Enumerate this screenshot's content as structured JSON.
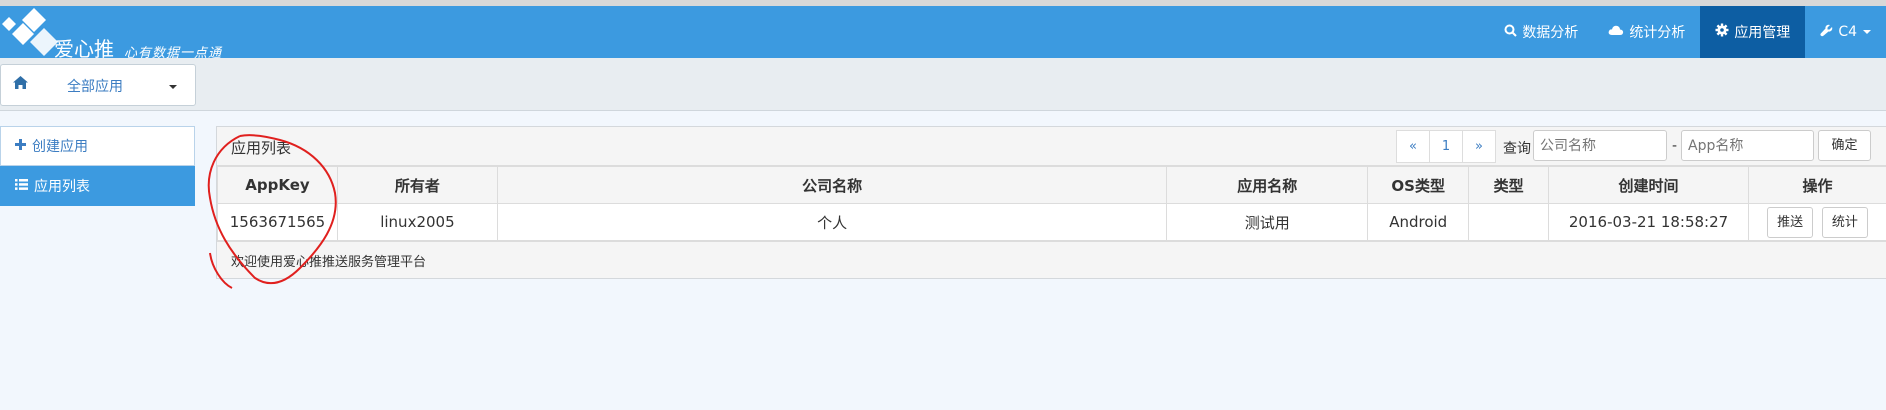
{
  "brand": {
    "name": "爱心推",
    "slogan": "心有数据一点通"
  },
  "nav": {
    "items": [
      {
        "icon": "search-icon",
        "label": "数据分析",
        "active": false
      },
      {
        "icon": "cloud-icon",
        "label": "统计分析",
        "active": false
      },
      {
        "icon": "gear-icon",
        "label": "应用管理",
        "active": true
      },
      {
        "icon": "wrench-icon",
        "label": "C4",
        "active": false
      }
    ]
  },
  "app_select": {
    "label": "全部应用"
  },
  "sidebar": {
    "items": [
      {
        "icon": "plus-icon",
        "label": "创建应用",
        "active": false
      },
      {
        "icon": "list-icon",
        "label": "应用列表",
        "active": true
      }
    ]
  },
  "panel": {
    "title": "应用列表",
    "pager": {
      "prev": "«",
      "page": "1",
      "next": "»"
    },
    "query_label": "查询",
    "company_placeholder": "公司名称",
    "dash": "-",
    "app_placeholder": "App名称",
    "ok_label": "确定",
    "footer": "欢迎使用爱心推推送服务管理平台"
  },
  "table": {
    "columns": [
      "AppKey",
      "所有者",
      "公司名称",
      "应用名称",
      "OS类型",
      "类型",
      "创建时间",
      "操作"
    ],
    "rows": [
      {
        "appkey": "1563671565",
        "owner": "linux2005",
        "company": "个人",
        "app_name": "测试用",
        "os": "Android",
        "type": "",
        "created": "2016-03-21 18:58:27",
        "actions": [
          "推送",
          "统计"
        ]
      }
    ]
  },
  "colors": {
    "navbar": "#3c9ae0",
    "nav_active": "#0d5ea3",
    "link": "#3c7dc2",
    "annotation": "#e0201e"
  }
}
